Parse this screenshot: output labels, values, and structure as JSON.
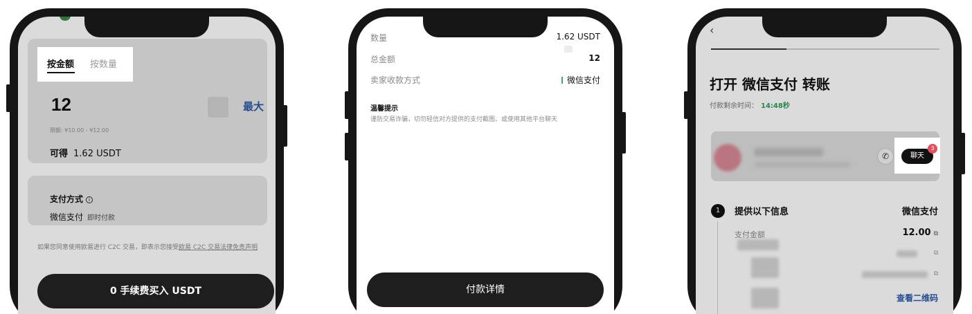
{
  "phone1": {
    "tabs": [
      {
        "label": "按金额",
        "active": true
      },
      {
        "label": "按数量",
        "active": false
      }
    ],
    "amount": "12",
    "max_label": "最大",
    "limit_text": "限额: ¥10.00 - ¥12.00",
    "receive_label": "可得",
    "receive_value": "1.62 USDT",
    "payment_section_label": "支付方式",
    "payment_method": "微信支付",
    "payment_speed": "即时付款",
    "agreement_prefix": "如果您同意使用欧易进行 C2C 交易，即表示您接受",
    "agreement_link": "欧易 C2C 交易法律免责声明",
    "buy_button": "0 手续费买入 USDT"
  },
  "phone2": {
    "rows": [
      {
        "label": "数量",
        "value": "1.62 USDT"
      },
      {
        "label": "总金额",
        "value": "12"
      },
      {
        "label": "卖家收款方式",
        "value": "微信支付"
      }
    ],
    "tips_title": "温馨提示",
    "tips_body": "谨防交易诈骗，切勿轻信对方提供的支付截图、或使用其他平台聊天",
    "pay_detail_button": "付款详情"
  },
  "phone3": {
    "back_icon": "chevron-left-icon",
    "progress": 0.33,
    "title": "打开 微信支付 转账",
    "remaining_label": "付款剩余时间：",
    "remaining_value": "14:48秒",
    "chat_button": "聊天",
    "chat_badge": "3",
    "step_number": "1",
    "step_title": "提供以下信息",
    "step_method": "微信支付",
    "amount_label": "支付金额",
    "amount_value": "12.00",
    "qr_link": "查看二维码"
  },
  "colors": {
    "accent_blue": "#2b5aa8",
    "timer_green": "#2e9d5a",
    "button_dark": "#1e1e1e",
    "badge_red": "#e0505d"
  }
}
